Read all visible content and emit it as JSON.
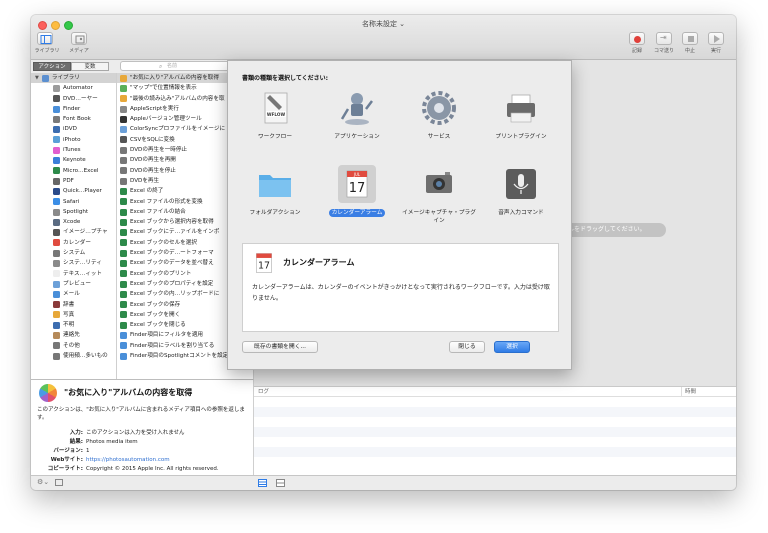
{
  "window": {
    "title": "名称未設定"
  },
  "toolbar": {
    "library_label": "ライブラリ",
    "media_label": "メディア",
    "record_label": "記録",
    "step_label": "コマ送り",
    "stop_label": "中止",
    "run_label": "実行"
  },
  "tabs": {
    "actions": "アクション",
    "variables": "変数"
  },
  "search": {
    "placeholder": "名前"
  },
  "library": {
    "header": "ライブラリ",
    "items": [
      {
        "label": "Automator",
        "color": "#9b9b9b"
      },
      {
        "label": "DVD…ーヤー",
        "color": "#555555"
      },
      {
        "label": "Finder",
        "color": "#4a8fd9"
      },
      {
        "label": "Font Book",
        "color": "#7a7a7a"
      },
      {
        "label": "iDVD",
        "color": "#3c6db0"
      },
      {
        "label": "iPhoto",
        "color": "#5aa0d8"
      },
      {
        "label": "iTunes",
        "color": "#e25fd0"
      },
      {
        "label": "Keynote",
        "color": "#3c7fd9"
      },
      {
        "label": "Micro…Excel",
        "color": "#2d8a4a"
      },
      {
        "label": "PDF",
        "color": "#666666"
      },
      {
        "label": "Quick…Player",
        "color": "#2a4a8a"
      },
      {
        "label": "Safari",
        "color": "#3b8ee6"
      },
      {
        "label": "Spotlight",
        "color": "#8a8a8a"
      },
      {
        "label": "Xcode",
        "color": "#5a6b82"
      },
      {
        "label": "イメージ…プチャ",
        "color": "#555555"
      },
      {
        "label": "カレンダー",
        "color": "#e04b3f"
      },
      {
        "label": "システム",
        "color": "#777777"
      },
      {
        "label": "システ…リティ",
        "color": "#8a8a8a"
      },
      {
        "label": "テキス…ィット",
        "color": "#eeeeee"
      },
      {
        "label": "プレビュー",
        "color": "#6ca0d8"
      },
      {
        "label": "メール",
        "color": "#4a8fd9"
      },
      {
        "label": "辞書",
        "color": "#8a3a3a"
      },
      {
        "label": "写真",
        "color": "#e7a83a"
      },
      {
        "label": "不明",
        "color": "#3c6db0"
      },
      {
        "label": "連絡先",
        "color": "#b58a5a"
      },
      {
        "label": "その他",
        "color": "#777777"
      },
      {
        "label": "使用頻…多いもの",
        "color": "#777777"
      }
    ]
  },
  "actions": [
    {
      "label": "\"お気に入り\"アルバムの内容を取得",
      "color": "#e7a83a",
      "selected": true
    },
    {
      "label": "\"マップ\"で位置情報を表示",
      "color": "#5ab05a"
    },
    {
      "label": "\"最後の読み込み\"アルバムの内容を取",
      "color": "#e7a83a"
    },
    {
      "label": "AppleScriptを実行",
      "color": "#888888"
    },
    {
      "label": "Appleバージョン管理ツール",
      "color": "#333333"
    },
    {
      "label": "ColorSyncプロファイルをイメージに",
      "color": "#6ca0d8"
    },
    {
      "label": "CSVをSQLに変換",
      "color": "#555555"
    },
    {
      "label": "DVDの再生を一時停止",
      "color": "#777777"
    },
    {
      "label": "DVDの再生を再開",
      "color": "#777777"
    },
    {
      "label": "DVDの再生を停止",
      "color": "#777777"
    },
    {
      "label": "DVDを再生",
      "color": "#777777"
    },
    {
      "label": "Excel の終了",
      "color": "#2d8a4a"
    },
    {
      "label": "Excel ファイルの形式を変換",
      "color": "#2d8a4a"
    },
    {
      "label": "Excel ファイルの結合",
      "color": "#2d8a4a"
    },
    {
      "label": "Excel ブックから選択内容を取得",
      "color": "#2d8a4a"
    },
    {
      "label": "Excel ブックにテ…ァイルをインポ",
      "color": "#2d8a4a"
    },
    {
      "label": "Excel ブックのセルを選択",
      "color": "#2d8a4a"
    },
    {
      "label": "Excel ブックのデ…ートフォーマ",
      "color": "#2d8a4a"
    },
    {
      "label": "Excel ブックのデータを並べ替え",
      "color": "#2d8a4a"
    },
    {
      "label": "Excel ブックのプリント",
      "color": "#2d8a4a"
    },
    {
      "label": "Excel ブックのプロパティを設定",
      "color": "#2d8a4a"
    },
    {
      "label": "Excel ブックの内…リップボードに",
      "color": "#2d8a4a"
    },
    {
      "label": "Excel ブックの保存",
      "color": "#2d8a4a"
    },
    {
      "label": "Excel ブックを開く",
      "color": "#2d8a4a"
    },
    {
      "label": "Excel ブックを閉じる",
      "color": "#2d8a4a"
    },
    {
      "label": "Finder項目にフィルタを適用",
      "color": "#4a8fd9"
    },
    {
      "label": "Finder項目にラベルを割り当てる",
      "color": "#4a8fd9"
    },
    {
      "label": "Finder項目のSpotlightコメントを設定",
      "color": "#4a8fd9"
    }
  ],
  "description": {
    "title": "\"お気に入り\"アルバムの内容を取得",
    "text": "このアクションは、\"お気に入り\"アルバムに含まれるメディア項目への参照を返します。",
    "input_key": "入力:",
    "input_val": "このアクションは入力を受け入れません",
    "result_key": "結果:",
    "result_val": "Photos media item",
    "version_key": "バージョン:",
    "version_val": "1",
    "website_key": "Webサイト:",
    "website_val": "https://photosautomation.com",
    "copyright_key": "コピーライト:",
    "copyright_val": "Copyright © 2015 Apple Inc. All rights reserved."
  },
  "workflow": {
    "hint": "…イルをドラッグしてください。",
    "log_label": "ログ",
    "duration_label": "時間"
  },
  "sheet": {
    "prompt": "書類の種類を選択してください:",
    "types": [
      {
        "label": "ワークフロー",
        "icon": "workflow-icon"
      },
      {
        "label": "アプリケーション",
        "icon": "application-icon"
      },
      {
        "label": "サービス",
        "icon": "service-icon"
      },
      {
        "label": "プリントプラグイン",
        "icon": "print-plugin-icon"
      },
      {
        "label": "フォルダアクション",
        "icon": "folder-action-icon"
      },
      {
        "label": "カレンダーアラーム",
        "icon": "calendar-alarm-icon",
        "selected": true
      },
      {
        "label": "イメージキャプチャ・プラグイン",
        "icon": "image-capture-icon"
      },
      {
        "label": "音声入力コマンド",
        "icon": "dictation-icon"
      }
    ],
    "info_title": "カレンダーアラーム",
    "info_text": "カレンダーアラームは、カレンダーのイベントがきっかけとなって実行されるワークフローです。入力は受け取りません。",
    "calendar_month": "JUL",
    "calendar_day": "17",
    "open_existing": "既存の書類を開く...",
    "close": "閉じる",
    "choose": "選択"
  },
  "colors": {
    "accent": "#3a7ee4",
    "record": "#e0403a"
  }
}
